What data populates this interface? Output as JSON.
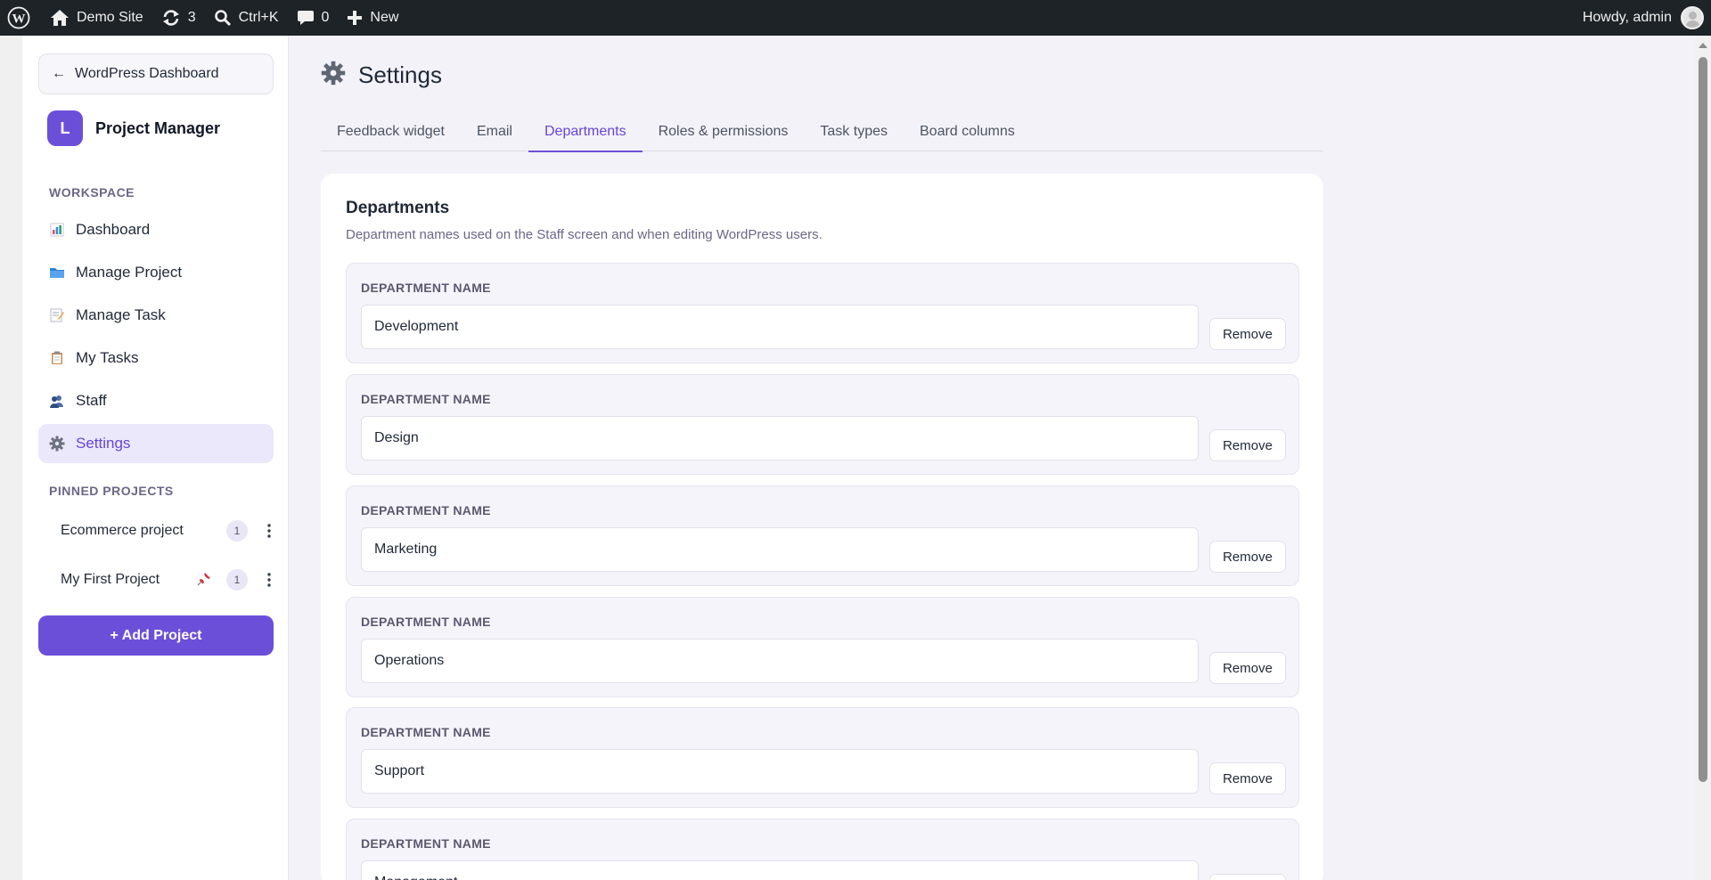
{
  "adminbar": {
    "site_name": "Demo Site",
    "updates_count": "3",
    "search_shortcut": "Ctrl+K",
    "comments_count": "0",
    "new_label": "New",
    "greeting": "Howdy, admin"
  },
  "sidebar": {
    "back_label": "WordPress Dashboard",
    "brand_letter": "L",
    "brand_name": "Project Manager",
    "workspace_label": "WORKSPACE",
    "items": [
      {
        "label": "Dashboard",
        "icon": "bar-chart-icon"
      },
      {
        "label": "Manage Project",
        "icon": "folder-icon"
      },
      {
        "label": "Manage Task",
        "icon": "memo-icon"
      },
      {
        "label": "My Tasks",
        "icon": "clipboard-icon"
      },
      {
        "label": "Staff",
        "icon": "people-icon"
      },
      {
        "label": "Settings",
        "icon": "gear-icon",
        "active": true
      }
    ],
    "pinned_label": "PINNED PROJECTS",
    "pinned": [
      {
        "name": "Ecommerce project",
        "count": "1",
        "pinned": false
      },
      {
        "name": "My First Project",
        "count": "1",
        "pinned": true
      }
    ],
    "add_project_label": "+ Add Project"
  },
  "main": {
    "title": "Settings",
    "tabs": [
      {
        "label": "Feedback widget"
      },
      {
        "label": "Email"
      },
      {
        "label": "Departments",
        "active": true
      },
      {
        "label": "Roles & permissions"
      },
      {
        "label": "Task types"
      },
      {
        "label": "Board columns"
      }
    ],
    "card": {
      "title": "Departments",
      "description": "Department names used on the Staff screen and when editing WordPress users.",
      "field_label": "DEPARTMENT NAME",
      "remove_label": "Remove",
      "departments": [
        "Development",
        "Design",
        "Marketing",
        "Operations",
        "Support",
        "Management"
      ]
    }
  },
  "colors": {
    "accent": "#6c4fd8",
    "active_bg": "#ebe8fb",
    "adminbar_bg": "#1d2327",
    "page_bg": "#f3f2f8"
  }
}
